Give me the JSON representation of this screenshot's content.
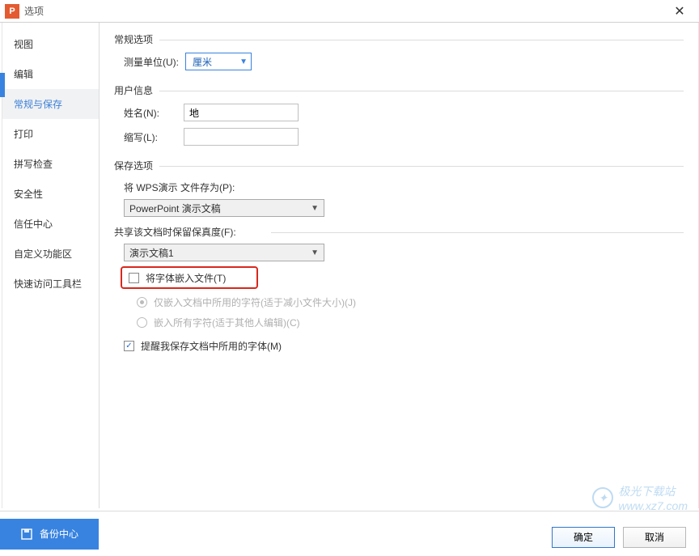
{
  "titlebar": {
    "title": "选项"
  },
  "sidebar": {
    "items": [
      {
        "label": "视图"
      },
      {
        "label": "编辑"
      },
      {
        "label": "常规与保存"
      },
      {
        "label": "打印"
      },
      {
        "label": "拼写检查"
      },
      {
        "label": "安全性"
      },
      {
        "label": "信任中心"
      },
      {
        "label": "自定义功能区"
      },
      {
        "label": "快速访问工具栏"
      }
    ],
    "backup_center": "备份中心"
  },
  "content": {
    "general": {
      "legend": "常规选项",
      "measure_label": "测量单位(U):",
      "measure_value": "厘米"
    },
    "user": {
      "legend": "用户信息",
      "name_label": "姓名(N):",
      "name_value": "地",
      "initials_label": "缩写(L):",
      "initials_value": ""
    },
    "save": {
      "legend": "保存选项",
      "save_as_label": "将 WPS演示 文件存为(P):",
      "save_as_value": "PowerPoint 演示文稿",
      "fidelity_legend": "共享该文档时保留保真度(F):",
      "fidelity_value": "演示文稿1",
      "embed_fonts_label": "将字体嵌入文件(T)",
      "embed_option1": "仅嵌入文档中所用的字符(适于减小文件大小)(J)",
      "embed_option2": "嵌入所有字符(适于其他人编辑)(C)",
      "remind_label": "提醒我保存文档中所用的字体(M)"
    }
  },
  "footer": {
    "ok": "确定",
    "cancel": "取消"
  },
  "watermark": {
    "line1": "极光下载站",
    "line2": "www.xz7.com"
  }
}
